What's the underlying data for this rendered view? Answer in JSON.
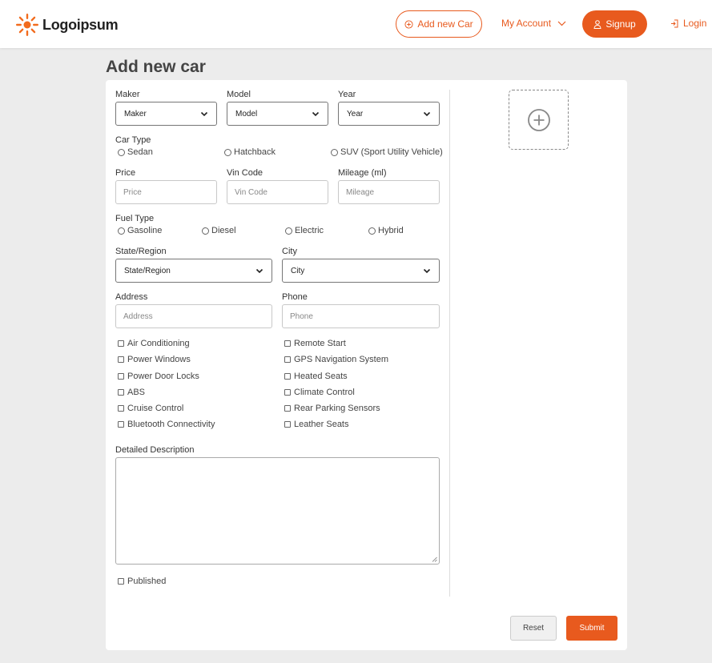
{
  "header": {
    "logo_text": "Logoipsum",
    "add_car_label": "Add new Car",
    "my_account_label": "My Account",
    "signup_label": "Signup",
    "login_label": "Login"
  },
  "page": {
    "title": "Add new car"
  },
  "form": {
    "maker": {
      "label": "Maker",
      "value": "Maker"
    },
    "model": {
      "label": "Model",
      "value": "Model"
    },
    "year": {
      "label": "Year",
      "value": "Year"
    },
    "car_type": {
      "label": "Car Type",
      "options": [
        "Sedan",
        "Hatchback",
        "SUV (Sport Utility Vehicle)"
      ]
    },
    "price": {
      "label": "Price",
      "placeholder": "Price"
    },
    "vin_code": {
      "label": "Vin Code",
      "placeholder": "Vin Code"
    },
    "mileage": {
      "label": "Mileage (ml)",
      "placeholder": "Mileage"
    },
    "fuel_type": {
      "label": "Fuel Type",
      "options": [
        "Gasoline",
        "Diesel",
        "Electric",
        "Hybrid"
      ]
    },
    "state": {
      "label": "State/Region",
      "value": "State/Region"
    },
    "city": {
      "label": "City",
      "value": "City"
    },
    "address": {
      "label": "Address",
      "placeholder": "Address"
    },
    "phone": {
      "label": "Phone",
      "placeholder": "Phone"
    },
    "features_left": [
      "Air Conditioning",
      "Power Windows",
      "Power Door Locks",
      "ABS",
      "Cruise Control",
      "Bluetooth Connectivity"
    ],
    "features_right": [
      "Remote Start",
      "GPS Navigation System",
      "Heated Seats",
      "Climate Control",
      "Rear Parking Sensors",
      "Leather Seats"
    ],
    "description": {
      "label": "Detailed Description"
    },
    "published_label": "Published",
    "reset_label": "Reset",
    "submit_label": "Submit"
  },
  "colors": {
    "accent": "#e85a1e",
    "background": "#ececec",
    "card": "#ffffff"
  },
  "icons": [
    "logo-sun-icon",
    "plus-circle-icon",
    "chevron-down-icon",
    "user-icon",
    "login-icon",
    "add-image-icon"
  ]
}
